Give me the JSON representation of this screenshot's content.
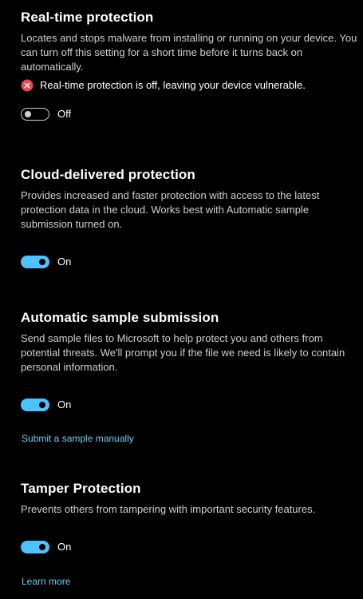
{
  "colors": {
    "background": "#000000",
    "accent": "#4cc2ff",
    "link": "#6ccdf5",
    "error": "#e74856"
  },
  "realtime": {
    "title": "Real-time protection",
    "description": "Locates and stops malware from installing or running on your device. You can turn off this setting for a short time before it turns back on automatically.",
    "warning_icon": "error-circle-icon",
    "warning": "Real-time protection is off, leaving your device vulnerable.",
    "toggle_state": "off",
    "toggle_label": "Off"
  },
  "cloud": {
    "title": "Cloud-delivered protection",
    "description": "Provides increased and faster protection with access to the latest protection data in the cloud. Works best with Automatic sample submission turned on.",
    "toggle_state": "on",
    "toggle_label": "On"
  },
  "sample": {
    "title": "Automatic sample submission",
    "description": "Send sample files to Microsoft to help protect you and others from potential threats. We'll prompt you if the file we need is likely to contain personal information.",
    "toggle_state": "on",
    "toggle_label": "On",
    "link": "Submit a sample manually"
  },
  "tamper": {
    "title": "Tamper Protection",
    "description": "Prevents others from tampering with important security features.",
    "toggle_state": "on",
    "toggle_label": "On",
    "link": "Learn more"
  }
}
